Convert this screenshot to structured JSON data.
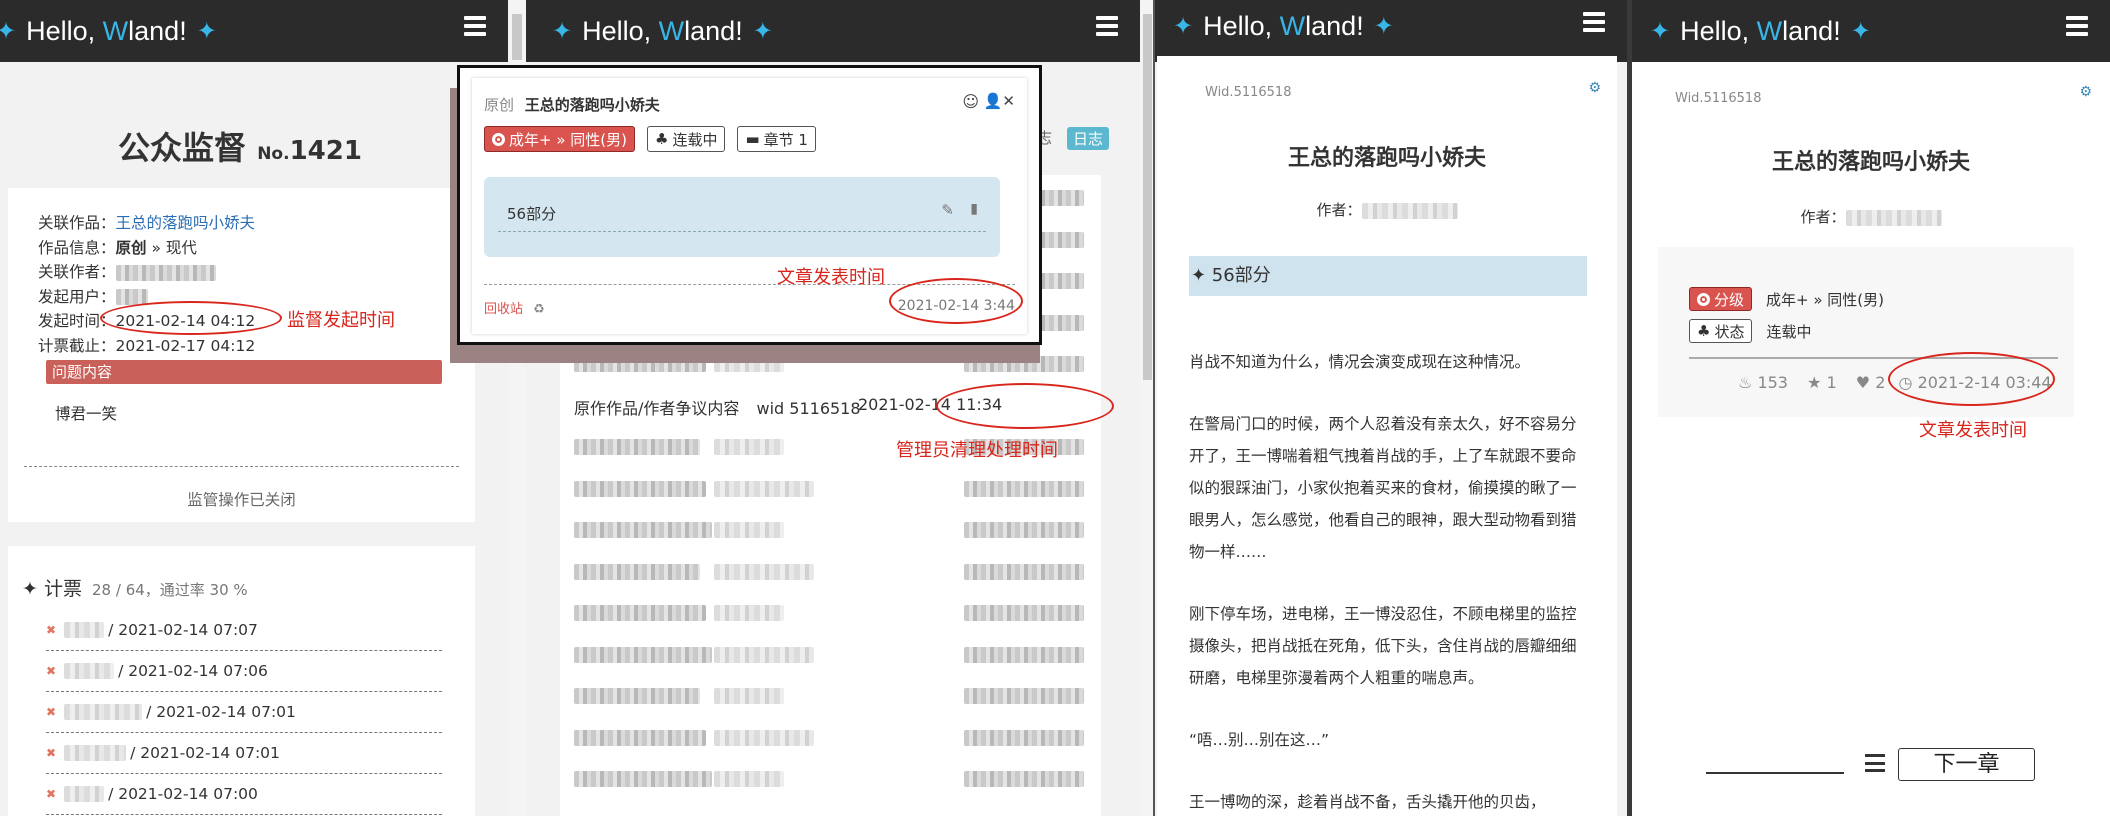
{
  "brand": {
    "hello": "Hello,",
    "w": "W",
    "rest": "land!",
    "star": "✦"
  },
  "p1": {
    "title": "公众监督",
    "no_prefix": "No.",
    "no": "1421",
    "info": [
      {
        "label": "关联作品：",
        "value": "王总的落跑吗小娇夫",
        "type": "link"
      },
      {
        "label": "作品信息：",
        "value": "原创",
        "value2": " » 现代",
        "type": "bold"
      },
      {
        "label": "关联作者：",
        "value": "",
        "type": "blur"
      },
      {
        "label": "发起用户：",
        "value": "",
        "type": "blur"
      },
      {
        "label": "发起时间：",
        "value": "2021-02-14 04:12",
        "type": "text"
      },
      {
        "label": "计票截止：",
        "value": "2021-02-17 04:12",
        "type": "text"
      }
    ],
    "issue_label": "问题内容",
    "issue_text": "博君一笑",
    "closed_text": "监管操作已关闭",
    "vote_title": "✦ 计票",
    "vote_stats": "28 / 64，通过率 30 %",
    "votes": [
      {
        "time": "/ 2021-02-14 07:07"
      },
      {
        "time": "/ 2021-02-14 07:06"
      },
      {
        "time": "/ 2021-02-14 07:01"
      },
      {
        "time": "/ 2021-02-14 07:01"
      },
      {
        "time": "/ 2021-02-14 07:00"
      }
    ],
    "annot_time": "监督发起时间"
  },
  "p2": {
    "popup": {
      "type": "原创",
      "title": "王总的落跑吗小娇夫",
      "tag1": "成年+ » 同性(男)",
      "tag2": "连载中",
      "tag3": "章节 1",
      "chapter": "56部分",
      "recycle": "回收站",
      "time": "2021-02-14 3:44"
    },
    "chip_partial": "志",
    "chip_log": "日志",
    "row_text": "原作作品/作者争议内容",
    "row_wid": "wid 5116518",
    "row_time": "2021-02-14 11:34",
    "annot_publish": "文章发表时间",
    "annot_admin": "管理员清理处理时间"
  },
  "p3": {
    "wid": "Wid.5116518",
    "title": "王总的落跑吗小娇夫",
    "author_label": "作者：",
    "chapter": "✦ 56部分",
    "paragraphs": [
      "肖战不知道为什么，情况会演变成现在这种情况。",
      "在警局门口的时候，两个人忍着没有亲太久，好不容易分开了，王一博喘着粗气拽着肖战的手，上了车就跟不要命似的狠踩油门，小家伙抱着买来的食材，偷摸摸的瞅了一眼男人，怎么感觉，他看自己的眼神，跟大型动物看到猎物一样……",
      "刚下停车场，进电梯，王一博没忍住，不顾电梯里的监控摄像头，把肖战抵在死角，低下头，含住肖战的唇瓣细细研磨，电梯里弥漫着两个人粗重的喘息声。",
      "“唔…别…别在这…”",
      "王一博吻的深，趁着肖战不备，舌头撬开他的贝齿，"
    ]
  },
  "p4": {
    "wid": "Wid.5116518",
    "title": "王总的落跑吗小娇夫",
    "author_label": "作者：",
    "rating_label": "分级",
    "rating_value": "成年+ » 同性(男)",
    "status_label": "状态",
    "status_value": "连载中",
    "stat_views": "153",
    "stat_stars": "1",
    "stat_hearts": "2",
    "publish_time": "2021-2-14 03:44",
    "annot_publish": "文章发表时间",
    "next_button": "下一章"
  },
  "colors": {
    "accent": "#38b6e8",
    "annot": "#d9261c",
    "issue_bg": "#c9615a",
    "chapter_bg": "#cfe3ee",
    "topbar": "#2b2b2b"
  }
}
